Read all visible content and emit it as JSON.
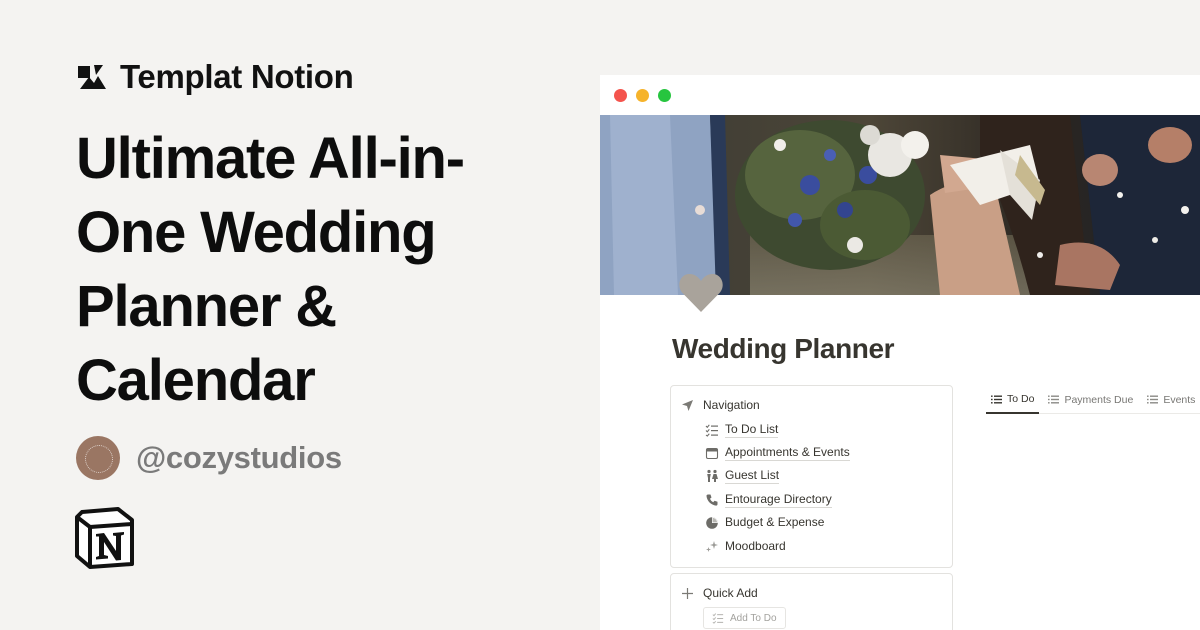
{
  "brand": {
    "name": "Templat Notion"
  },
  "headline": {
    "lines": [
      "Ultimate All-in-",
      "One Wedding",
      "Planner &",
      "Calendar"
    ]
  },
  "author": {
    "handle": "@cozystudios",
    "avatar_text": "cozy studios"
  },
  "window": {
    "traffic_lights": [
      "#f4544d",
      "#f6b32b",
      "#27c53f"
    ],
    "page_icon": "heart-icon",
    "page_title": "Wedding Planner",
    "navigation": {
      "title": "Navigation",
      "items": [
        {
          "label": "To Do List",
          "icon": "checklist-icon"
        },
        {
          "label": "Appointments & Events",
          "icon": "calendar-icon"
        },
        {
          "label": "Guest List",
          "icon": "people-icon"
        },
        {
          "label": "Entourage Directory",
          "icon": "phone-icon"
        },
        {
          "label": "Budget & Expense",
          "icon": "pie-chart-icon"
        },
        {
          "label": "Moodboard",
          "icon": "sparkles-icon"
        }
      ]
    },
    "quick_add": {
      "title": "Quick Add",
      "button_label": "Add To Do"
    },
    "tabs": [
      {
        "label": "To Do",
        "active": true
      },
      {
        "label": "Payments Due",
        "active": false
      },
      {
        "label": "Events",
        "active": false
      }
    ]
  },
  "colors": {
    "background": "#f4f3f1",
    "text": "#111111",
    "muted": "#7a7a7a",
    "notion_text": "#37352f",
    "heart": "#a9a39b"
  }
}
